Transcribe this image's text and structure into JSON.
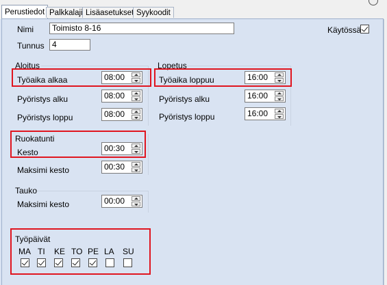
{
  "tabs": [
    {
      "label": "Perustiedot",
      "active": true
    },
    {
      "label": "Palkkalajit",
      "active": false
    },
    {
      "label": "Lisäasetukset",
      "active": false
    },
    {
      "label": "Syykoodit",
      "active": false
    }
  ],
  "general": {
    "name_label": "Nimi",
    "name_value": "Toimisto 8-16",
    "id_label": "Tunnus",
    "id_value": "4",
    "active_label": "Käytössä",
    "active_checked": true
  },
  "start": {
    "title": "Aloitus",
    "work_start_label": "Työaika alkaa",
    "work_start_value": "08:00",
    "round_start_label": "Pyöristys alku",
    "round_start_value": "08:00",
    "round_end_label": "Pyöristys loppu",
    "round_end_value": "08:00"
  },
  "end": {
    "title": "Lopetus",
    "work_end_label": "Työaika loppuu",
    "work_end_value": "16:00",
    "round_start_label": "Pyöristys alku",
    "round_start_value": "16:00",
    "round_end_label": "Pyöristys loppu",
    "round_end_value": "16:00"
  },
  "lunch": {
    "title": "Ruokatunti",
    "duration_label": "Kesto",
    "duration_value": "00:30",
    "max_label": "Maksimi kesto",
    "max_value": "00:30"
  },
  "break": {
    "title": "Tauko",
    "max_label": "Maksimi kesto",
    "max_value": "00:00"
  },
  "workdays": {
    "title": "Työpäivät",
    "days": [
      {
        "label": "MA",
        "checked": true
      },
      {
        "label": "TI",
        "checked": true
      },
      {
        "label": "KE",
        "checked": true
      },
      {
        "label": "TO",
        "checked": true
      },
      {
        "label": "PE",
        "checked": true
      },
      {
        "label": "LA",
        "checked": false
      },
      {
        "label": "SU",
        "checked": false
      }
    ]
  },
  "colors": {
    "highlight": "#e0141e",
    "background": "#d9e3f2"
  }
}
